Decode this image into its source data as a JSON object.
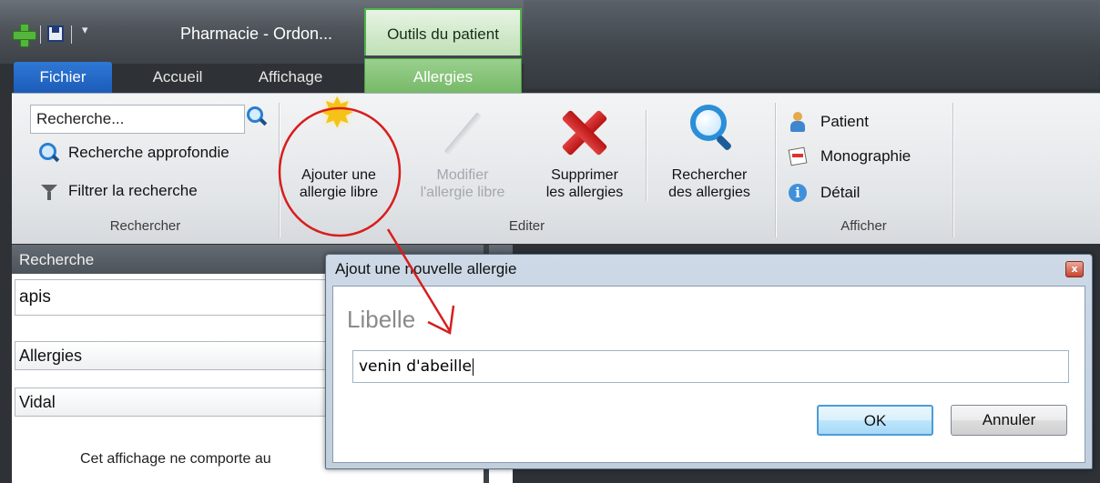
{
  "window": {
    "app_title": "Pharmacie - Ordon...",
    "context_group": "Outils du patient"
  },
  "tabs": [
    {
      "label": "Fichier"
    },
    {
      "label": "Accueil"
    },
    {
      "label": "Affichage"
    },
    {
      "label": "Allergies",
      "active": true
    }
  ],
  "ribbon": {
    "rechercher": {
      "search_value": "Recherche...",
      "advanced_search": "Recherche approfondie",
      "filter_search": "Filtrer la recherche",
      "group_label": "Rechercher"
    },
    "editer": {
      "add_line1": "Ajouter une",
      "add_line2": "allergie libre",
      "modify_line1": "Modifier",
      "modify_line2": "l'allergie libre",
      "delete_line1": "Supprimer",
      "delete_line2": "les allergies",
      "search_line1": "Rechercher",
      "search_line2": "des allergies",
      "group_label": "Editer"
    },
    "afficher": {
      "patient": "Patient",
      "monographie": "Monographie",
      "detail": "Détail",
      "group_label": "Afficher"
    }
  },
  "left_panel": {
    "header": "Recherche",
    "query": "apis",
    "category": "Allergies",
    "source": "Vidal",
    "empty_text": "Cet affichage ne comporte au"
  },
  "dialog": {
    "title": "Ajout une nouvelle allergie",
    "close_label": "x",
    "field_label": "Libelle",
    "field_value": "venin d'abeille",
    "ok_label": "OK",
    "cancel_label": "Annuler"
  },
  "colors": {
    "annotation": "#d81d1d",
    "context_tab": "#75b867",
    "file_tab": "#1b5cb8"
  }
}
